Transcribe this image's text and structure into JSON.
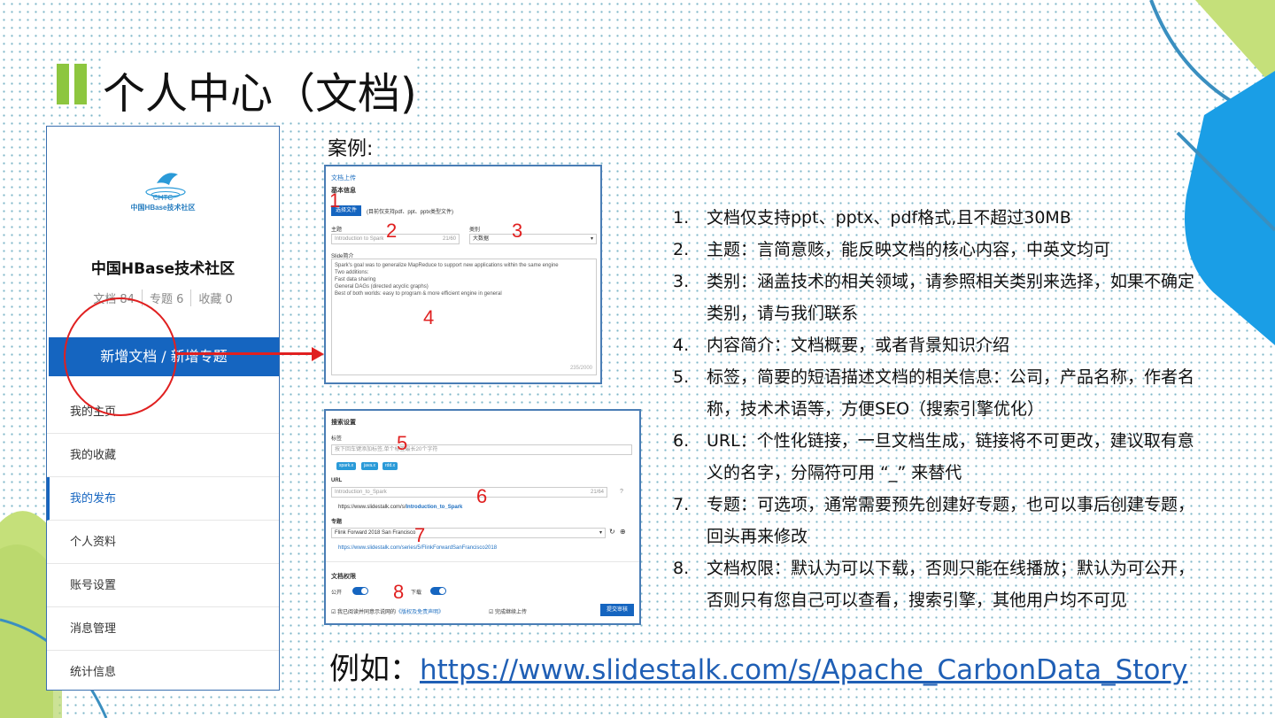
{
  "title": "个人中心（文档)",
  "sidebar": {
    "logo_text1": "CHTC",
    "logo_text2": "中国HBase技术社区",
    "site_name": "中国HBase技术社区",
    "stats": [
      "文档 84",
      "专题 6",
      "收藏 0"
    ],
    "new_button": "新增文档 / 新增专题",
    "nav": [
      "我的主页",
      "我的收藏",
      "我的发布",
      "个人资料",
      "账号设置",
      "消息管理",
      "统计信息"
    ],
    "active_nav": "我的发布"
  },
  "example_label": "案例:",
  "shot1": {
    "heading": "文档上传",
    "basic_info": "基本信息",
    "choose_file": "选择文件",
    "file_hint": "(目前仅支持pdf、ppt、pptx类型文件)",
    "subject_label": "主题",
    "subject_value": "Introduction to Spark",
    "subject_count": "21/60",
    "category_label": "类别",
    "category_value": "大数据",
    "intro_label": "Slide简介",
    "intro_lines": [
      "Spark's goal was to generalize MapReduce to support new applications within the same engine",
      "Two additions:",
      "Fast data sharing",
      "General DAGs (directed acyclic graphs)",
      "Best of both worlds: easy to program & more efficient engine in general"
    ],
    "intro_count": "235/2000",
    "markers": [
      "1",
      "2",
      "3",
      "4"
    ]
  },
  "shot2": {
    "heading": "搜索设置",
    "tags_label": "标签",
    "tags_placeholder": "按下回车键添加标签,单个标签最长20个字符",
    "tags": [
      "spark.x",
      "java.x",
      "rdd.x"
    ],
    "url_label": "URL",
    "url_value": "Introduction_to_Spark",
    "url_count": "21/64",
    "url_prefix": "https://www.slidestalk.com/s/",
    "url_slug": "Introduction_to_Spark",
    "topic_label": "专题",
    "topic_value": "Flink Forward 2018 San Francisco",
    "topic_url": "https://www.slidestalk.com/series/5/FlinkForwardSanFrancisco2018",
    "perm_heading": "文档权限",
    "public_label": "公开",
    "download_label": "下载",
    "agree_text": "我已阅读并同意示说网的",
    "agree_link": "《版权及免责声明》",
    "continue_upload": "完成继续上传",
    "submit": "提交审核",
    "markers": [
      "5",
      "6",
      "7",
      "8"
    ]
  },
  "notes": [
    {
      "num": "1.",
      "text": "文档仅支持ppt、pptx、pdf格式,且不超过30MB"
    },
    {
      "num": "2.",
      "text": "主题：言简意赅，能反映文档的核心内容，中英文均可"
    },
    {
      "num": "3.",
      "text": "类别：涵盖技术的相关领域，请参照相关类别来选择，如果不确定类别，请与我们联系"
    },
    {
      "num": "4.",
      "text": "内容简介：文档概要，或者背景知识介绍"
    },
    {
      "num": "5.",
      "text": "标签，简要的短语描述文档的相关信息：公司，产品名称，作者名称，技术术语等，方便SEO（搜索引擎优化）"
    },
    {
      "num": "6.",
      "text": "URL：个性化链接，一旦文档生成，链接将不可更改，建议取有意义的名字，分隔符可用 “_” 来替代"
    },
    {
      "num": "7.",
      "text": "专题：可选项，通常需要预先创建好专题，也可以事后创建专题，回头再来修改"
    },
    {
      "num": "8.",
      "text": "文档权限：默认为可以下载，否则只能在线播放；默认为可公开，否则只有您自己可以查看，搜索引擎，其他用户均不可见"
    }
  ],
  "bottom": {
    "prefix": "例如：",
    "link": "https://www.slidestalk.com/s/Apache_CarbonData_Story"
  },
  "colors": {
    "accent_green": "#8dc63f",
    "brand_blue": "#1565c0",
    "marker_red": "#e02020"
  }
}
